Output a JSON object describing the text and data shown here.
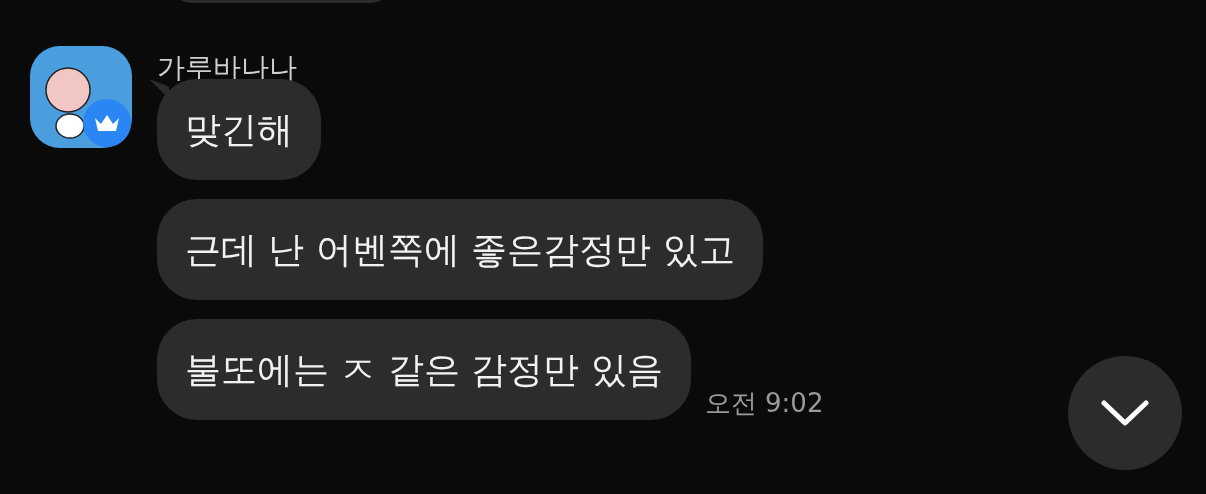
{
  "message_group": {
    "sender": "가루바나나",
    "messages": [
      {
        "text": "맞긴해"
      },
      {
        "text": "근데 난 어벤쪽에 좋은감정만 있고"
      },
      {
        "text": "불또에는 ㅈ 같은 감정만 있음"
      }
    ],
    "time": "오전 9:02"
  }
}
